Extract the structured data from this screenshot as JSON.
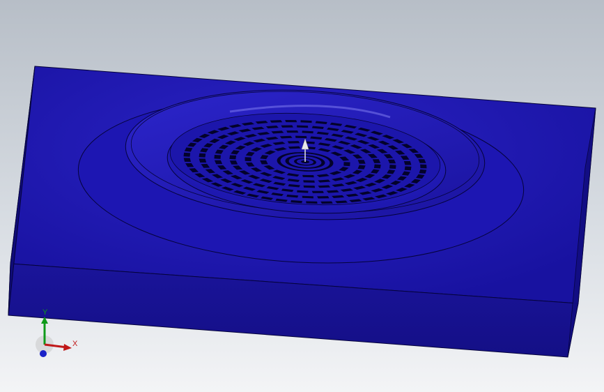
{
  "viewport": {
    "background_top": "#b7bec7",
    "background_bottom": "#f3f4f6"
  },
  "model": {
    "face_color": "#1a14a8",
    "front_color": "#17128f",
    "side_color": "#0f0c72",
    "edge_color": "#05033a"
  },
  "triad": {
    "x_label": "X",
    "y_label": "Y",
    "x_color": "#c01818",
    "y_color": "#0f9a1a",
    "z_color": "#1a22c8"
  }
}
